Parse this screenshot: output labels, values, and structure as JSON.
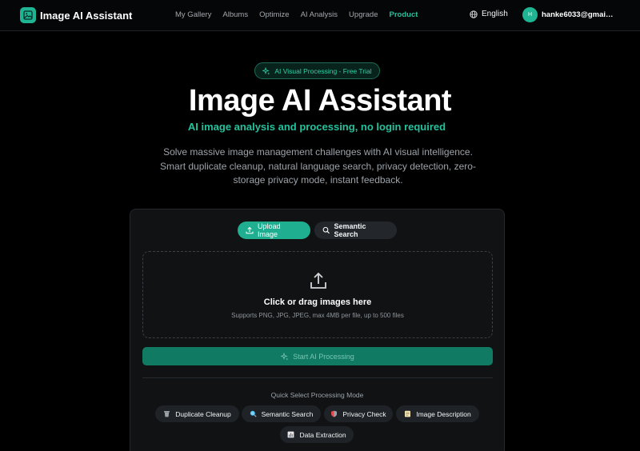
{
  "app": {
    "brand": "Image AI Assistant"
  },
  "nav": {
    "links": [
      "My Gallery",
      "Albums",
      "Optimize",
      "AI Analysis",
      "Upgrade",
      "Product"
    ],
    "language": "English",
    "user_initial": "H",
    "user_email": "hanke6033@gmai…"
  },
  "hero": {
    "badge": "AI Visual Processing - Free Trial",
    "title": "Image AI Assistant",
    "subtitle": "AI image analysis and processing, no login required",
    "description": "Solve massive image management challenges with AI visual intelligence. Smart duplicate cleanup, natural language search, privacy detection, zero-storage privacy mode, instant feedback."
  },
  "upload": {
    "tabs": [
      "Upload Image",
      "Semantic Search"
    ],
    "drop_title": "Click or drag images here",
    "drop_hint": "Supports PNG, JPG, JPEG, max 4MB per file, up to 500 files",
    "start_button": "Start AI Processing",
    "mode_label": "Quick Select Processing Mode",
    "modes": [
      "Duplicate Cleanup",
      "Semantic Search",
      "Privacy Check",
      "Image Description",
      "Data Extraction"
    ]
  },
  "colors": {
    "accent": "#1fb594",
    "background": "#000000",
    "card": "#101214"
  }
}
